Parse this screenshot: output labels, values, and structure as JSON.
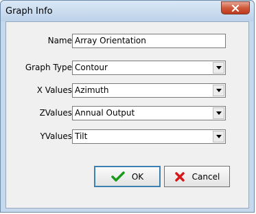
{
  "window": {
    "title": "Graph Info"
  },
  "form": {
    "name": {
      "label": "Name",
      "value": "Array Orientation"
    },
    "graph_type": {
      "label": "Graph Type",
      "value": "Contour"
    },
    "x_values": {
      "label": "X Values",
      "value": "Azimuth"
    },
    "z_values": {
      "label": "ZValues",
      "value": "Annual Output"
    },
    "y_values": {
      "label": "YValues",
      "value": "Tilt"
    }
  },
  "buttons": {
    "ok": "OK",
    "cancel": "Cancel"
  },
  "colors": {
    "ok_check": "#1a9a1a",
    "cancel_x": "#d81818",
    "close_bg": "#c74a2e"
  },
  "icons": {
    "close": "close-icon",
    "ok": "check-icon",
    "cancel": "x-icon",
    "dropdown": "chevron-down-icon"
  }
}
